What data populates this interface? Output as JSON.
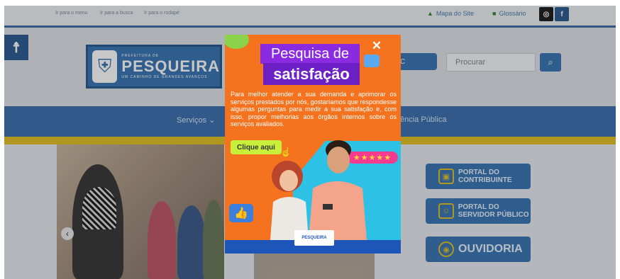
{
  "topbar": {
    "skip_links": [
      "Ir para o menu",
      "Ir para a busca",
      "Ir para o rodapé"
    ],
    "sitemap_label": "Mapa do Site",
    "glossary_label": "Glossário"
  },
  "header": {
    "logo_small": "PREFEITURA DE",
    "logo_big": "PESQUEIRA",
    "logo_sub": "UM CAMINHO DE GRANDES AVANÇOS",
    "ic_label": "C",
    "search_placeholder": "Procurar"
  },
  "nav": {
    "items": [
      "Serviços ⌄",
      "ência Pública"
    ]
  },
  "tiles": [
    {
      "label": "PORTAL DO CONTRIBUINTE"
    },
    {
      "label": "PORTAL DO SERVIDOR PÚBLICO"
    },
    {
      "label": "OUVIDORIA"
    }
  ],
  "popup": {
    "title_line1": "Pesquisa de",
    "title_line2": "satisfação",
    "body": "Para melhor atender a sua demanda e aprimorar os serviços prestados por nós, gostaríamos que respondesse algumas perguntas para medir a sua satisfação e, com isso, propor melhorias aos órgãos internos sobre os serviços avaliados.",
    "cta_label": "Clique aqui",
    "stars": "★★★★★",
    "logo_text": "PESQUEIRA",
    "close_label": "✕"
  },
  "colors": {
    "brand_blue": "#3d79b6",
    "nav_blue": "#3f74b3",
    "accent_yellow": "#e3c22a",
    "popup_orange": "#f5731e",
    "popup_purple": "#6c1fc4"
  }
}
